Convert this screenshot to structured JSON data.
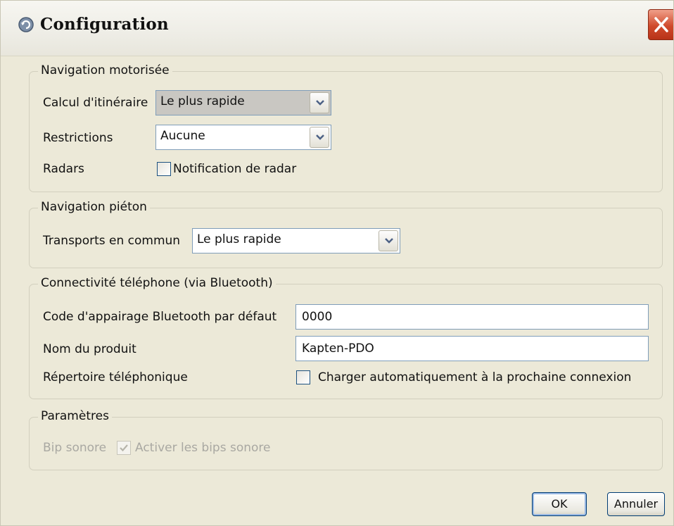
{
  "window": {
    "title": "Configuration"
  },
  "icons": {
    "app": "refresh-arrow-icon",
    "close": "close-icon",
    "dropdown": "chevron-down-icon",
    "check": "checkmark-icon"
  },
  "groups": {
    "nav_motor": {
      "title": "Navigation motorisée",
      "route_label": "Calcul d'itinéraire",
      "route_value": "Le plus rapide",
      "restrictions_label": "Restrictions",
      "restrictions_value": "Aucune",
      "radars_label": "Radars",
      "radar_checkbox_label": "Notification de radar",
      "radar_checked": false
    },
    "nav_pedestrian": {
      "title": "Navigation piéton",
      "transport_label": "Transports en commun",
      "transport_value": "Le plus rapide"
    },
    "bluetooth": {
      "title": "Connectivité téléphone (via Bluetooth)",
      "pairing_label": "Code d'appairage Bluetooth par défaut",
      "pairing_value": "0000",
      "product_label": "Nom du produit",
      "product_value": "Kapten-PDO",
      "phonebook_label": "Répertoire téléphonique",
      "phonebook_checkbox_label": "Charger automatiquement à la prochaine connexion",
      "phonebook_checked": false
    },
    "settings": {
      "title": "Paramètres",
      "beep_label": "Bip sonore",
      "beep_checkbox_label": "Activer les bips sonore",
      "beep_checked": true,
      "enabled": false
    }
  },
  "buttons": {
    "ok": "OK",
    "cancel": "Annuler"
  },
  "colors": {
    "window_bg": "#ece9d8",
    "close_red": "#d04a2c",
    "input_border": "#7f9db9",
    "checkbox_border": "#1c5180",
    "disabled_text": "#a9a8a2"
  }
}
